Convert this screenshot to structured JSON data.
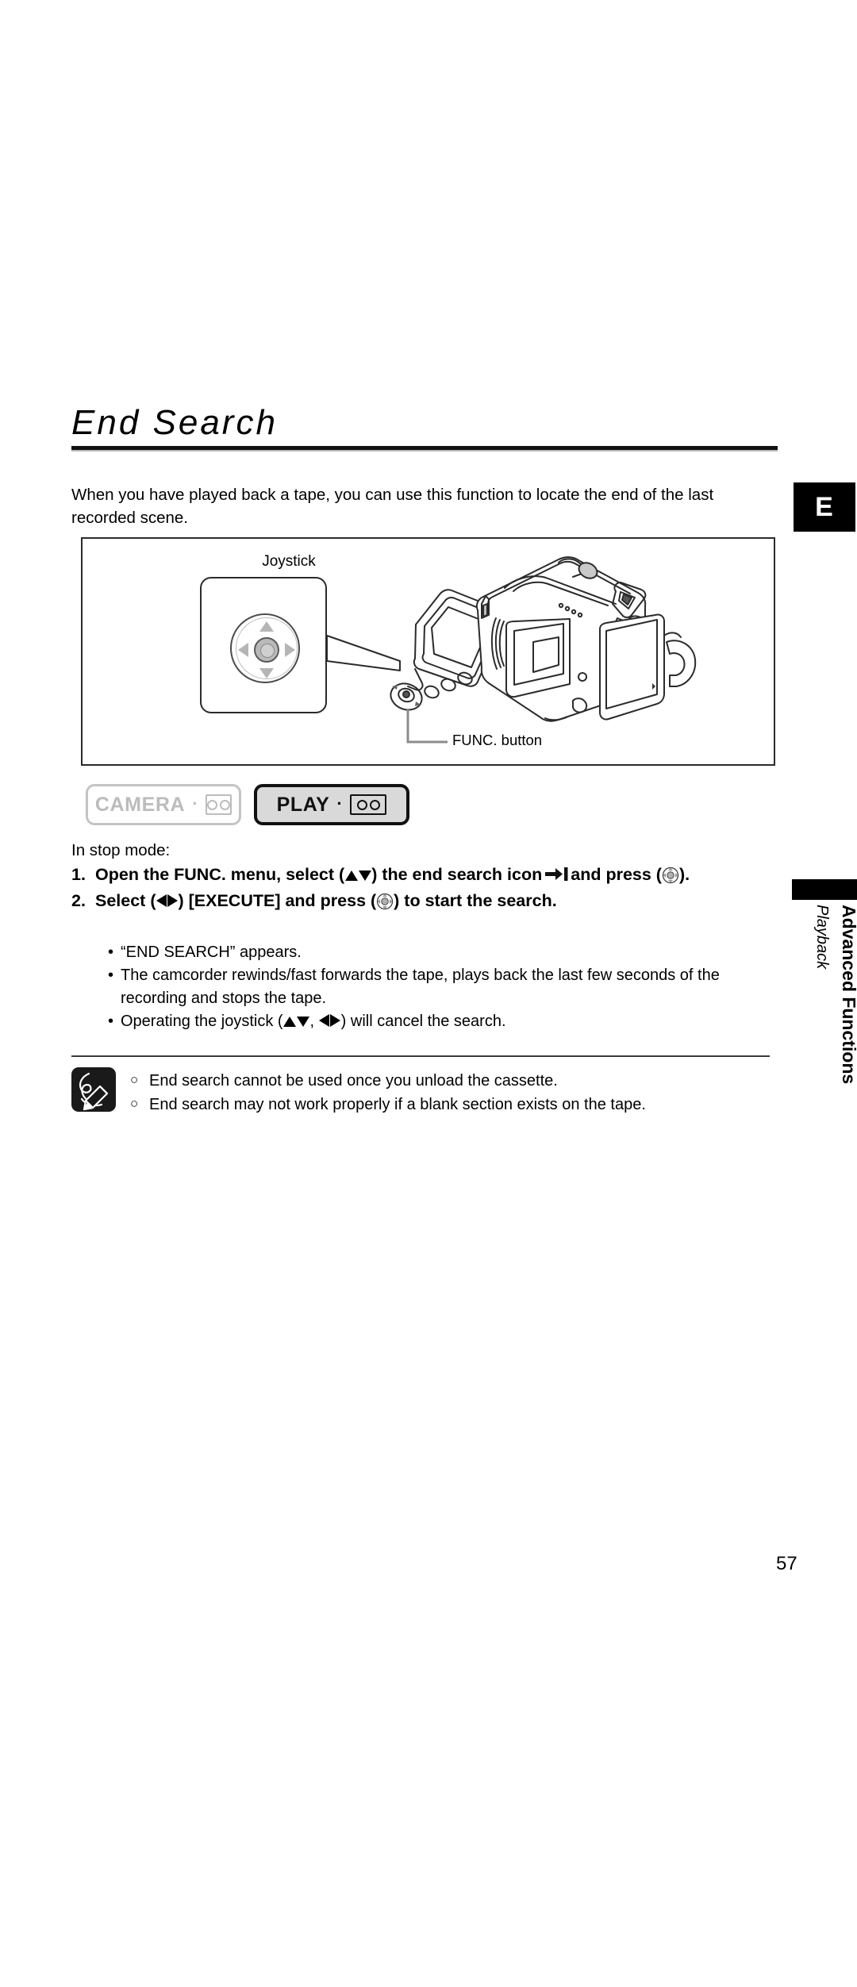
{
  "page": {
    "title": "End Search",
    "number": "57",
    "language_tab": "E"
  },
  "intro": "When you have played back a tape, you can use this function to locate the end of the last recorded scene.",
  "illustration": {
    "joystick_label": "Joystick",
    "func_button_label": "FUNC. button",
    "icons": {
      "joystick": "joystick-pad-icon",
      "camcorder": "camcorder-illustration"
    }
  },
  "modes": [
    {
      "label": "CAMERA",
      "media_icon": "tape-cassette-icon",
      "active": false
    },
    {
      "label": "PLAY",
      "media_icon": "tape-cassette-icon",
      "active": true
    }
  ],
  "procedure": {
    "precondition": "In stop mode:",
    "steps": [
      {
        "number": "1.",
        "part1": "Open the FUNC. menu, select (",
        "part2": ") the end search icon",
        "part3": "and press (",
        "part4": ")."
      },
      {
        "number": "2.",
        "part1": "Select (",
        "part2": ") [EXECUTE] and press (",
        "part3": ") to start the search."
      }
    ],
    "bullets": [
      {
        "marker": "•",
        "text": "“END SEARCH” appears."
      },
      {
        "marker": "•",
        "text": "The camcorder rewinds/fast forwards the tape, plays back the last few seconds of the recording and stops the tape."
      },
      {
        "marker": "•",
        "pre": "Operating the joystick (",
        "mid": ",",
        "post": ") will cancel the search."
      }
    ]
  },
  "notes": {
    "icon": "note-pencil-icon",
    "items": [
      {
        "marker": "○",
        "text": "End search cannot be used once you unload the cassette."
      },
      {
        "marker": "○",
        "text": "End search may not work properly if a blank section exists on the tape."
      }
    ]
  },
  "sidebar": {
    "section": "Advanced Functions",
    "subsection": "Playback"
  },
  "colors": {
    "text": "#000000",
    "rule": "#111111",
    "inactive": "#bcbcbc",
    "active_fill": "#d9d9d9",
    "tab_bg": "#000000"
  }
}
